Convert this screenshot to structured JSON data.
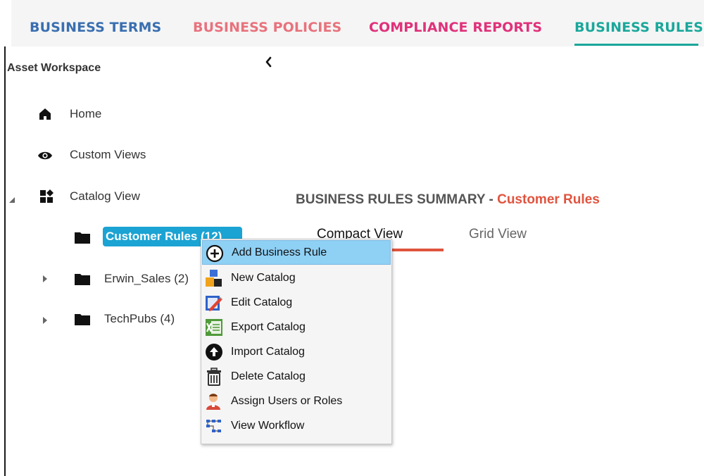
{
  "tabs": [
    {
      "label": "BUSINESS TERMS",
      "color": "#3a6fb0"
    },
    {
      "label": "BUSINESS POLICIES",
      "color": "#e8727d"
    },
    {
      "label": "COMPLIANCE REPORTS",
      "color": "#e0317a"
    },
    {
      "label": "BUSINESS RULES",
      "color": "#1aa79b",
      "active": true
    }
  ],
  "workspace": {
    "title": "Asset Workspace",
    "collapse_icon": "chevron-left-icon"
  },
  "tree": {
    "home": {
      "label": "Home",
      "icon": "home-icon"
    },
    "custom_views": {
      "label": "Custom Views",
      "icon": "eye-icon"
    },
    "catalog_view": {
      "label": "Catalog View",
      "icon": "catalog-icon",
      "expanded": true
    },
    "customer_rules": {
      "label": "Customer Rules (12)",
      "icon": "folder-icon",
      "selected": true
    },
    "erwin_sales": {
      "label": "Erwin_Sales (2)",
      "icon": "folder-icon"
    },
    "techpubs": {
      "label": "TechPubs (4)",
      "icon": "folder-icon"
    }
  },
  "summary": {
    "title": "BUSINESS RULES SUMMARY - ",
    "catalog": "Customer Rules",
    "accent_color": "#e0543f"
  },
  "view_tabs": [
    {
      "label": "Compact View",
      "active": true
    },
    {
      "label": "Grid View",
      "active": false
    }
  ],
  "context_menu": {
    "items": [
      {
        "label": "Add Business Rule",
        "icon": "add-circle-icon",
        "highlighted": true
      },
      {
        "label": "New Catalog",
        "icon": "new-catalog-icon"
      },
      {
        "label": "Edit Catalog",
        "icon": "edit-catalog-icon"
      },
      {
        "label": "Export Catalog",
        "icon": "export-excel-icon"
      },
      {
        "label": "Import Catalog",
        "icon": "upload-circle-icon"
      },
      {
        "label": "Delete Catalog",
        "icon": "trash-icon"
      },
      {
        "label": "Assign Users or Roles",
        "icon": "user-icon"
      },
      {
        "label": "View Workflow",
        "icon": "workflow-icon"
      }
    ]
  },
  "colors": {
    "selected_bg": "#1ba3d3",
    "menu_highlight": "#8fd0f5",
    "view_underline": "#e0543f",
    "tabbar_bg": "#f5f5f5"
  }
}
